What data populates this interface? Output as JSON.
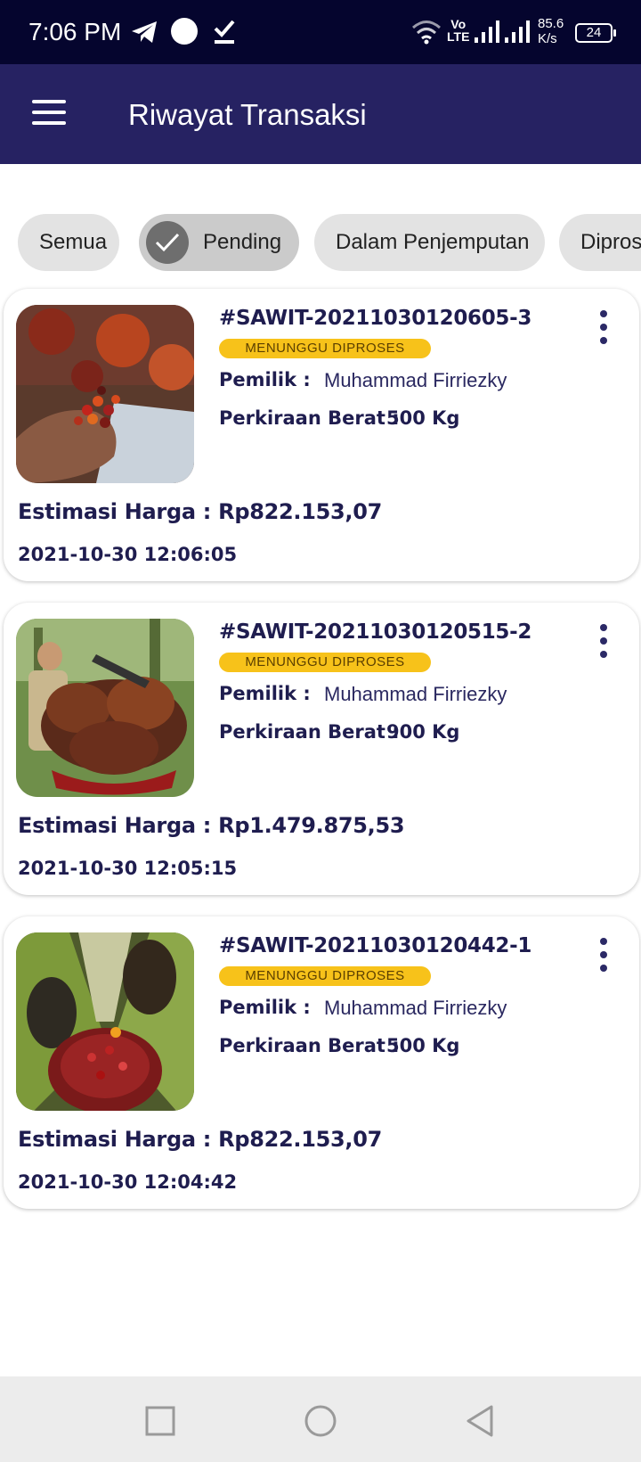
{
  "status_bar": {
    "time": "7:06 PM",
    "network_label_top": "Vo",
    "network_label_bottom": "LTE",
    "speed_value": "85.6",
    "speed_unit": "K/s",
    "battery": "24"
  },
  "app_bar": {
    "title": "Riwayat Transaksi",
    "menu_icon": "hamburger-menu-icon"
  },
  "filters": [
    {
      "label": "Semua",
      "selected": false
    },
    {
      "label": "Pending",
      "selected": true
    },
    {
      "label": "Dalam Penjemputan",
      "selected": false
    },
    {
      "label": "Dipros",
      "selected": false
    }
  ],
  "transactions": [
    {
      "id": "#SAWIT-20211030120605-3",
      "status": "MENUNGGU DIPROSES",
      "owner_label": "Pemilik :",
      "owner": "Muhammad Firriezky",
      "weight_label": "Perkiraan Berat :",
      "weight": "500 Kg",
      "price": "Estimasi Harga : Rp822.153,07",
      "date": "2021-10-30 12:06:05"
    },
    {
      "id": "#SAWIT-20211030120515-2",
      "status": "MENUNGGU DIPROSES",
      "owner_label": "Pemilik :",
      "owner": "Muhammad Firriezky",
      "weight_label": "Perkiraan Berat :",
      "weight": "900 Kg",
      "price": "Estimasi Harga : Rp1.479.875,53",
      "date": "2021-10-30 12:05:15"
    },
    {
      "id": "#SAWIT-20211030120442-1",
      "status": "MENUNGGU DIPROSES",
      "owner_label": "Pemilik :",
      "owner": "Muhammad Firriezky",
      "weight_label": "Perkiraan Berat :",
      "weight": "500 Kg",
      "price": "Estimasi Harga : Rp822.153,07",
      "date": "2021-10-30 12:04:42"
    }
  ],
  "colors": {
    "status_bar": "#05052e",
    "app_bar": "#262262",
    "badge": "#f7c21a",
    "text_primary": "#1f1d4f"
  },
  "nav_icons": [
    "recents-square-icon",
    "home-circle-icon",
    "back-triangle-icon"
  ]
}
